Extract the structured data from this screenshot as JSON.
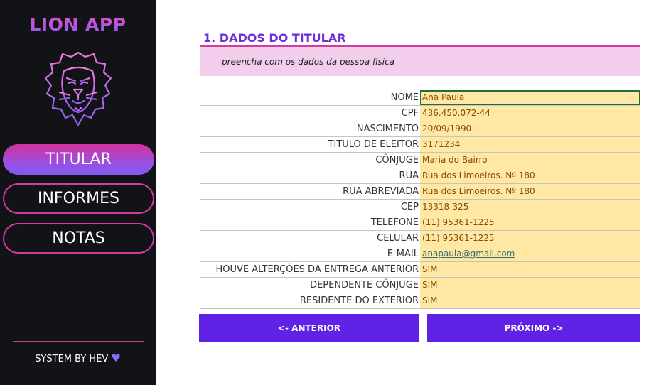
{
  "app": {
    "logo_text": "LION APP",
    "footer_text": "SYSTEM BY HEV",
    "brand_colors": {
      "pink": "#d63aa0",
      "purple": "#6023e6",
      "field": "#ffe8a4"
    }
  },
  "sidebar": {
    "items": [
      {
        "label": "TITULAR",
        "active": true
      },
      {
        "label": "INFORMES",
        "active": false
      },
      {
        "label": "NOTAS",
        "active": false
      }
    ]
  },
  "section": {
    "title": "1. DADOS DO TITULAR",
    "subtitle": "preencha com os dados da pessoa física"
  },
  "form": {
    "rows": [
      {
        "label": "NOME",
        "value": "Ana Paula"
      },
      {
        "label": "CPF",
        "value": "436.450.072-44"
      },
      {
        "label": "NASCIMENTO",
        "value": "20/09/1990"
      },
      {
        "label": "TITULO DE ELEITOR",
        "value": "3171234"
      },
      {
        "label": "CÔNJUGE",
        "value": "Maria do Bairro"
      },
      {
        "label": "RUA",
        "value": "Rua dos Limoeiros. Nº 180"
      },
      {
        "label": "RUA ABREVIADA",
        "value": "Rua dos Limoeiros. Nº 180"
      },
      {
        "label": "CEP",
        "value": "13318-325"
      },
      {
        "label": "TELEFONE",
        "value": "(11) 95361-1225"
      },
      {
        "label": "CELULAR",
        "value": "(11) 95361-1225"
      },
      {
        "label": "E-MAIL",
        "value": "anapaula@gmail.com"
      },
      {
        "label": "HOUVE ALTERÇÕES DA ENTREGA ANTERIOR",
        "value": "SIM"
      },
      {
        "label": "DEPENDENTE CÔNJUGE",
        "value": "SIM"
      },
      {
        "label": "RESIDENTE DO EXTERIOR",
        "value": "SIM"
      }
    ]
  },
  "buttons": {
    "prev_label": "<- ANTERIOR",
    "next_label": "PRÓXIMO ->"
  }
}
